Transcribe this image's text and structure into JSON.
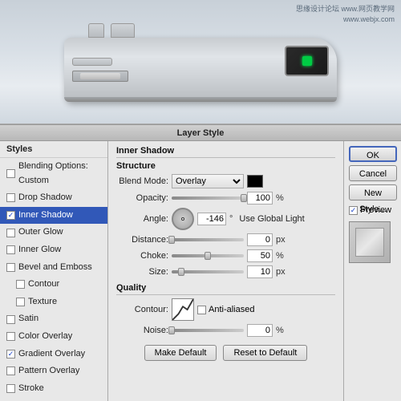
{
  "watermark": {
    "line1": "思缘设计论坛  www.网页教学网",
    "line2": "www.webjx.com"
  },
  "dialog": {
    "title": "Layer Style",
    "styles_header": "Styles",
    "style_items": [
      {
        "id": "blending-options",
        "label": "Blending Options: Custom",
        "checked": false,
        "selected": false,
        "indented": false
      },
      {
        "id": "drop-shadow",
        "label": "Drop Shadow",
        "checked": false,
        "selected": false,
        "indented": false
      },
      {
        "id": "inner-shadow",
        "label": "Inner Shadow",
        "checked": true,
        "selected": true,
        "indented": false
      },
      {
        "id": "outer-glow",
        "label": "Outer Glow",
        "checked": false,
        "selected": false,
        "indented": false
      },
      {
        "id": "inner-glow",
        "label": "Inner Glow",
        "checked": false,
        "selected": false,
        "indented": false
      },
      {
        "id": "bevel-emboss",
        "label": "Bevel and Emboss",
        "checked": false,
        "selected": false,
        "indented": false
      },
      {
        "id": "contour",
        "label": "Contour",
        "checked": false,
        "selected": false,
        "indented": true
      },
      {
        "id": "texture",
        "label": "Texture",
        "checked": false,
        "selected": false,
        "indented": true
      },
      {
        "id": "satin",
        "label": "Satin",
        "checked": false,
        "selected": false,
        "indented": false
      },
      {
        "id": "color-overlay",
        "label": "Color Overlay",
        "checked": false,
        "selected": false,
        "indented": false
      },
      {
        "id": "gradient-overlay",
        "label": "Gradient Overlay",
        "checked": true,
        "selected": false,
        "indented": false
      },
      {
        "id": "pattern-overlay",
        "label": "Pattern Overlay",
        "checked": false,
        "selected": false,
        "indented": false
      },
      {
        "id": "stroke",
        "label": "Stroke",
        "checked": false,
        "selected": false,
        "indented": false
      }
    ],
    "inner_shadow": {
      "section_title": "Inner Shadow",
      "structure_title": "Structure",
      "blend_mode_label": "Blend Mode:",
      "blend_mode_value": "Overlay",
      "opacity_label": "Opacity:",
      "opacity_value": "100",
      "opacity_unit": "%",
      "angle_label": "Angle:",
      "angle_value": "-146",
      "angle_unit": "°",
      "use_global_light": "Use Global Light",
      "distance_label": "Distance:",
      "distance_value": "0",
      "distance_unit": "px",
      "choke_label": "Choke:",
      "choke_value": "50",
      "choke_unit": "%",
      "size_label": "Size:",
      "size_value": "10",
      "size_unit": "px",
      "quality_title": "Quality",
      "contour_label": "Contour:",
      "anti_aliased": "Anti-aliased",
      "noise_label": "Noise:",
      "noise_value": "0",
      "noise_unit": "%",
      "make_default": "Make Default",
      "reset_to_default": "Reset to Default"
    },
    "actions": {
      "ok": "OK",
      "cancel": "Cancel",
      "new_style": "New Style...",
      "preview_label": "Preview"
    }
  }
}
